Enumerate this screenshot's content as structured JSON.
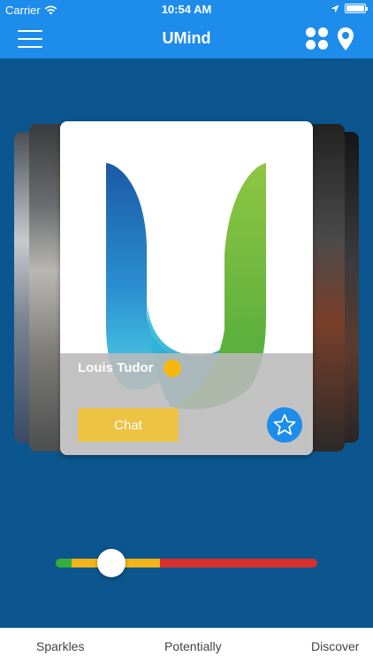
{
  "status_bar": {
    "carrier": "Carrier",
    "time": "10:54 AM"
  },
  "nav": {
    "title": "UMind",
    "menu_icon": "hamburger-menu-icon",
    "grid_icon": "grid-icon",
    "location_icon": "location-pin-icon"
  },
  "card": {
    "name": "Louis Tudor",
    "status_color": "#f5b712",
    "chat_label": "Chat",
    "favorite_icon": "star-icon"
  },
  "slider": {
    "value_fraction": 0.16,
    "segments": [
      "green",
      "yellow",
      "red"
    ]
  },
  "tabs": [
    {
      "label": "Sparkles"
    },
    {
      "label": "Potentially"
    },
    {
      "label": "Discover"
    }
  ],
  "colors": {
    "primary": "#1d8ceb",
    "background": "#0b568e",
    "chat_button": "#eec243",
    "slider_green": "#35ad3d",
    "slider_yellow": "#f3b31a",
    "slider_red": "#d8302c"
  }
}
